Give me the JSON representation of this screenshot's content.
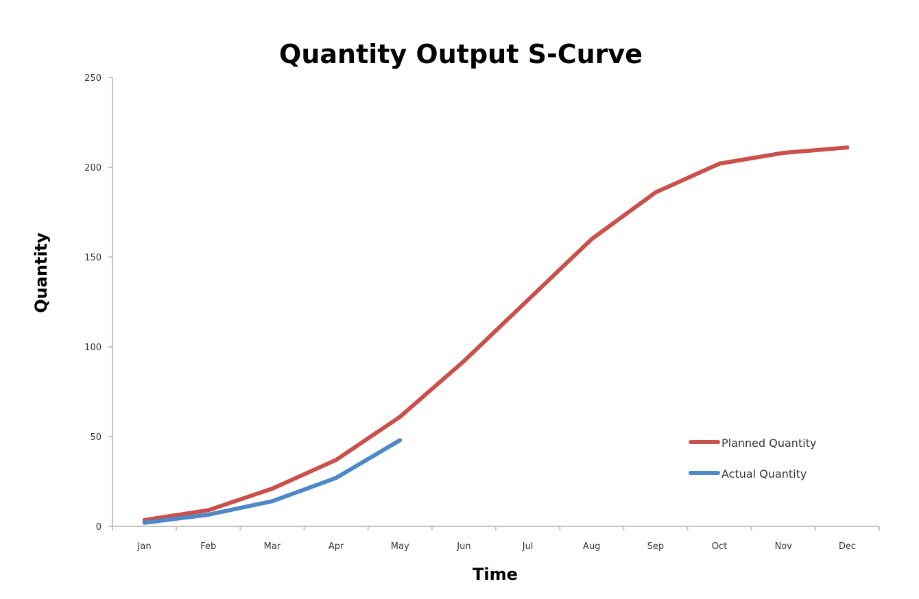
{
  "chart_data": {
    "type": "line",
    "title": "Quantity Output S-Curve",
    "xlabel": "Time",
    "ylabel": "Quantity",
    "categories": [
      "Jan",
      "Feb",
      "Mar",
      "Apr",
      "May",
      "Jun",
      "Jul",
      "Aug",
      "Sep",
      "Oct",
      "Nov",
      "Dec"
    ],
    "ylim": [
      0,
      250
    ],
    "yticks": [
      0,
      50,
      100,
      150,
      200,
      250
    ],
    "grid": false,
    "legend_position": "bottom-right",
    "series": [
      {
        "name": "Planned Quantity",
        "color": "#C9504B",
        "values": [
          3.5,
          9,
          21,
          37,
          61,
          92,
          126,
          160,
          186,
          202,
          208,
          211
        ]
      },
      {
        "name": "Actual Quantity",
        "color": "#4F88C6",
        "values": [
          2,
          6.5,
          14,
          27,
          48
        ]
      }
    ]
  }
}
